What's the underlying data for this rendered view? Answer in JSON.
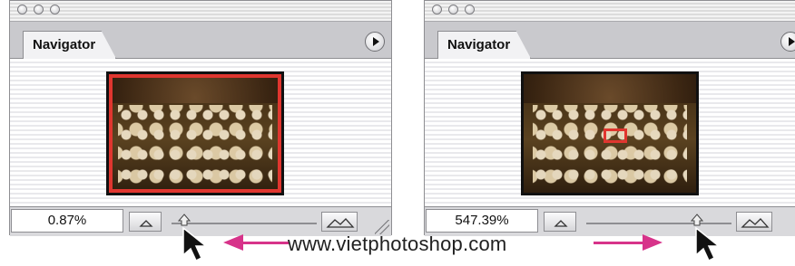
{
  "panels": [
    {
      "tab_label": "Navigator",
      "zoom_value": "0.87%"
    },
    {
      "tab_label": "Navigator",
      "zoom_value": "547.39%"
    }
  ],
  "caption": "www.vietphotoshop.com",
  "colors": {
    "arrow": "#d7338a",
    "view_box": "#e0362f"
  },
  "icons": {
    "menu": "circle-play-icon",
    "zoom_out": "small-mountain-icon",
    "zoom_in": "large-mountain-icon",
    "cursor": "mouse-pointer-icon"
  }
}
